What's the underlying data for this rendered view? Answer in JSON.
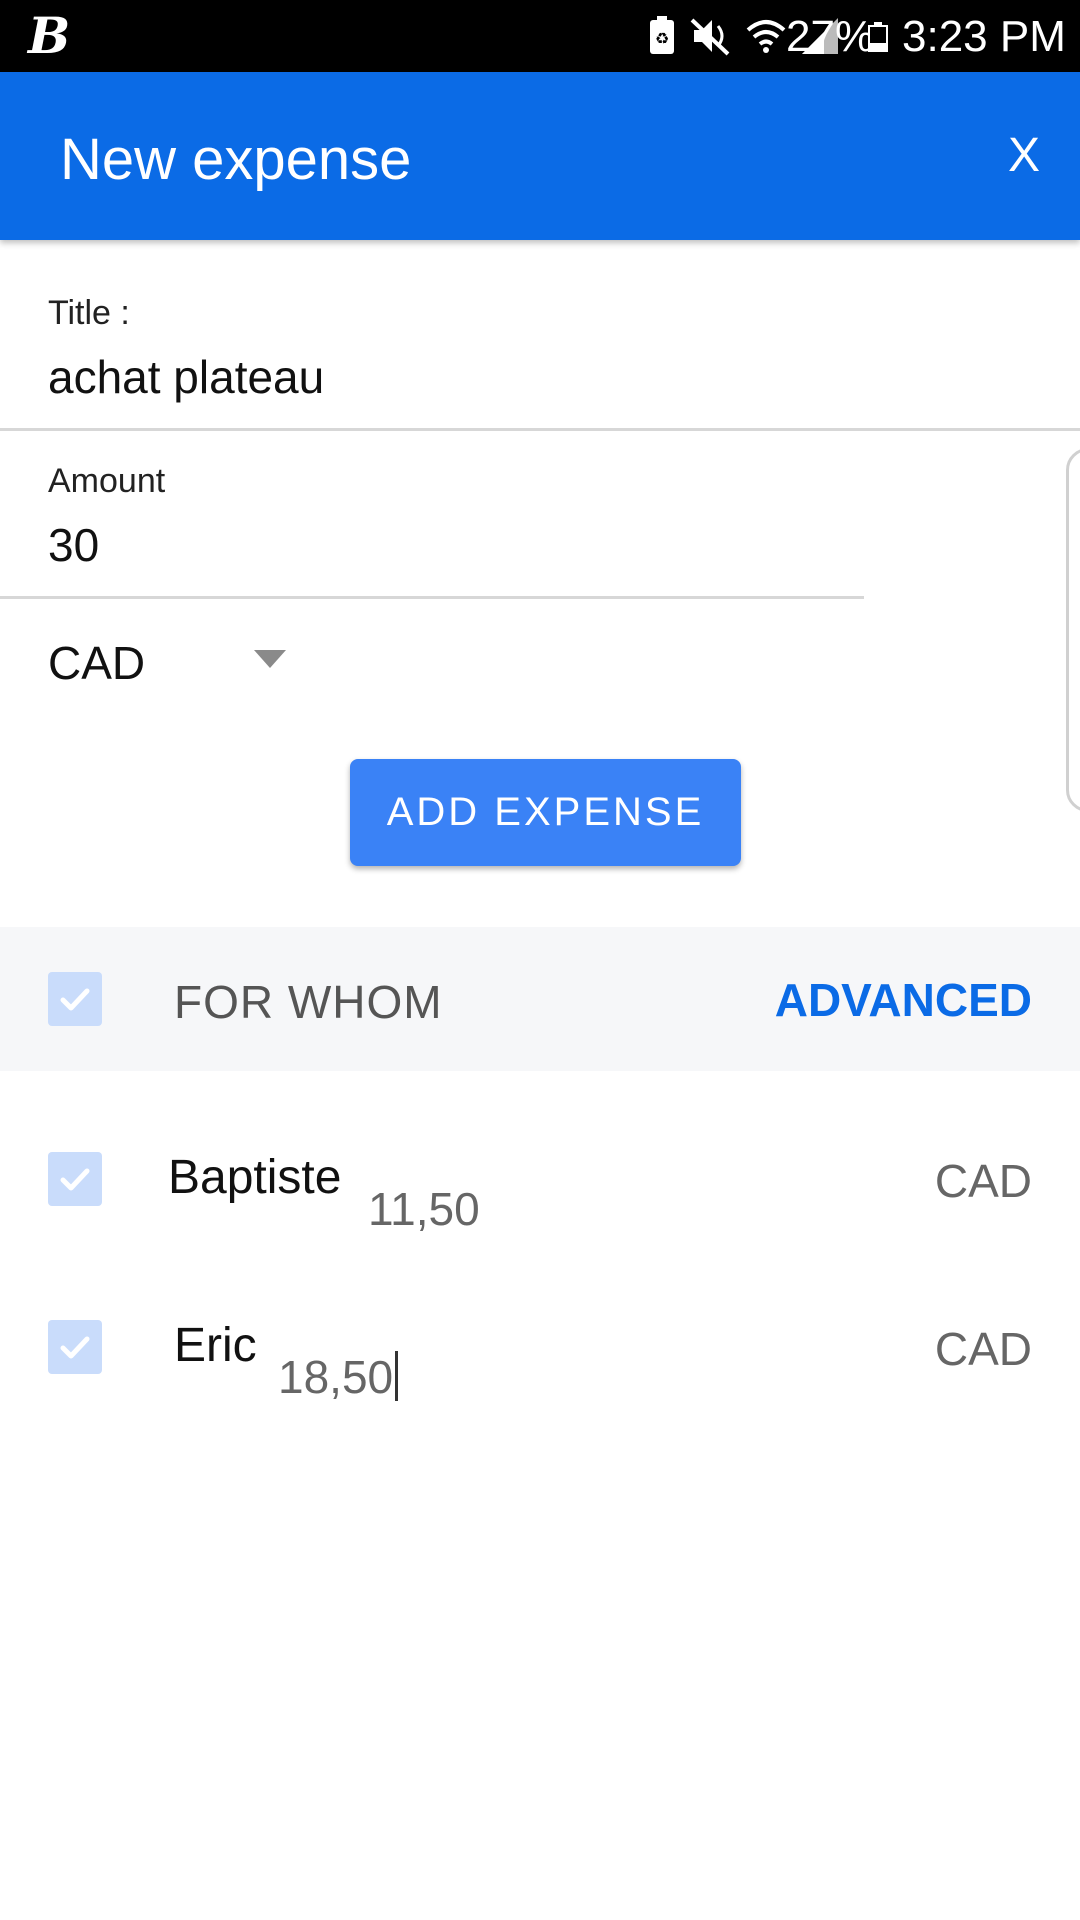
{
  "status_bar": {
    "app_logo": "B",
    "battery_percent": "27%",
    "time": "3:23 PM"
  },
  "header": {
    "title": "New expense",
    "close_label": "X"
  },
  "form": {
    "title_label": "Title :",
    "title_value": "achat plateau",
    "amount_label": "Amount",
    "amount_value": "30",
    "currency_value": "CAD",
    "add_button": "ADD EXPENSE"
  },
  "for_whom": {
    "label": "FOR WHOM",
    "advanced": "ADVANCED",
    "all_checked": true
  },
  "participants": [
    {
      "name": "Baptiste",
      "amount": "11,50",
      "currency": "CAD",
      "checked": true
    },
    {
      "name": "Eric",
      "amount": "18,50",
      "currency": "CAD",
      "checked": true
    }
  ],
  "colors": {
    "app_bar": "#0b6be6",
    "button": "#3a82f6",
    "checkbox": "#c9dcfb"
  }
}
